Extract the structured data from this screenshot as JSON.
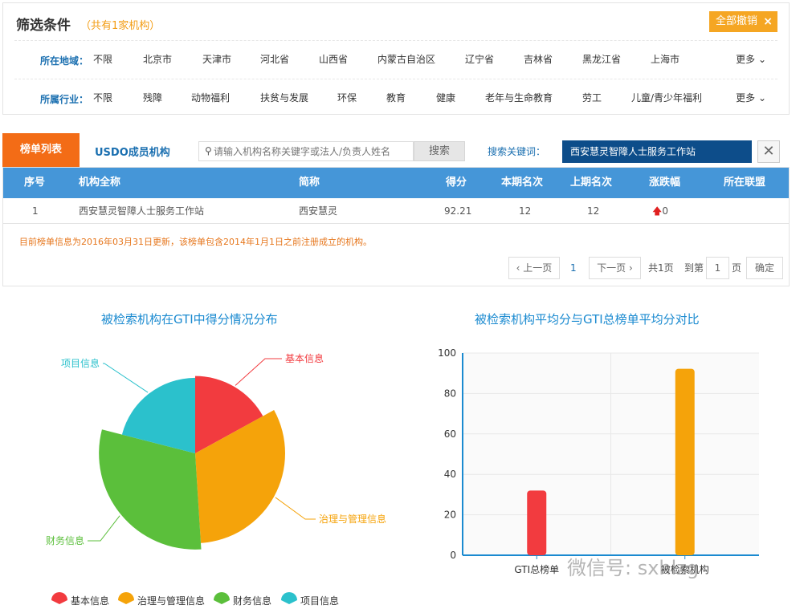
{
  "filter": {
    "title": "筛选条件",
    "count": "（共有1家机构）",
    "clear_all": "全部撤销",
    "clear_icon": "×",
    "region": {
      "label": "所在地域：",
      "options": [
        "不限",
        "北京市",
        "天津市",
        "河北省",
        "山西省",
        "内蒙古自治区",
        "辽宁省",
        "吉林省",
        "黑龙江省",
        "上海市"
      ],
      "more": "更多"
    },
    "industry": {
      "label": "所属行业：",
      "options": [
        "不限",
        "残障",
        "动物福利",
        "扶贫与发展",
        "环保",
        "教育",
        "健康",
        "老年与生命教育",
        "劳工",
        "儿童/青少年福利"
      ],
      "more": "更多"
    }
  },
  "tabs": {
    "ranking": "榜单列表",
    "members": "USDO成员机构"
  },
  "search": {
    "placeholder": "请输入机构名称关键字或法人/负责人姓名",
    "button": "搜索",
    "keyword_label": "搜索关键词：",
    "keyword_value": "西安慧灵智障人士服务工作站",
    "close_icon": "✕"
  },
  "table": {
    "headers": [
      "序号",
      "机构全称",
      "简称",
      "得分",
      "本期名次",
      "上期名次",
      "涨跌幅",
      "所在联盟"
    ],
    "rows": [
      {
        "no": "1",
        "full_name": "西安慧灵智障人士服务工作站",
        "short_name": "西安慧灵",
        "score": "92.21",
        "rank_now": "12",
        "rank_prev": "12",
        "change": "0",
        "alliance": ""
      }
    ],
    "note": "目前榜单信息为2016年03月31日更新，该榜单包含2014年1月1日之前注册成立的机构。"
  },
  "pager": {
    "prev": "上一页",
    "current": "1",
    "next": "下一页",
    "total": "共1页",
    "goto_prefix": "到第",
    "goto_value": "1",
    "goto_suffix": "页",
    "confirm": "确定"
  },
  "charts": {
    "colors": {
      "red": "#f23b3f",
      "orange": "#f5a30a",
      "green": "#5bbf3b",
      "cyan": "#2bc1cc"
    },
    "pie_title": "被检索机构在GTI中得分情况分布",
    "bar_title": "被检索机构平均分与GTI总榜单平均分对比"
  },
  "chart_data": [
    {
      "type": "pie",
      "title": "被检索机构在GTI中得分情况分布",
      "slices": [
        {
          "label": "基本信息",
          "value": 17,
          "color": "#f23b3f",
          "radius_ratio": 0.86
        },
        {
          "label": "治理与管理信息",
          "value": 32,
          "color": "#f5a30a",
          "radius_ratio": 1.0
        },
        {
          "label": "财务信息",
          "value": 30,
          "color": "#5bbf3b",
          "radius_ratio": 1.07
        },
        {
          "label": "项目信息",
          "value": 21,
          "color": "#2bc1cc",
          "radius_ratio": 0.84
        }
      ],
      "legend": [
        "基本信息",
        "治理与管理信息",
        "财务信息",
        "项目信息"
      ],
      "legend_position": "bottom"
    },
    {
      "type": "bar",
      "title": "被检索机构平均分与GTI总榜单平均分对比",
      "categories": [
        "GTI总榜单",
        "被检索机构"
      ],
      "values": [
        32,
        92.21
      ],
      "colors": [
        "#f23b3f",
        "#f5a30a"
      ],
      "ylim": [
        0,
        100
      ],
      "yticks": [
        0,
        20,
        40,
        60,
        80,
        100
      ],
      "grid": true
    }
  ],
  "watermark": "微信号: sxhlzg"
}
